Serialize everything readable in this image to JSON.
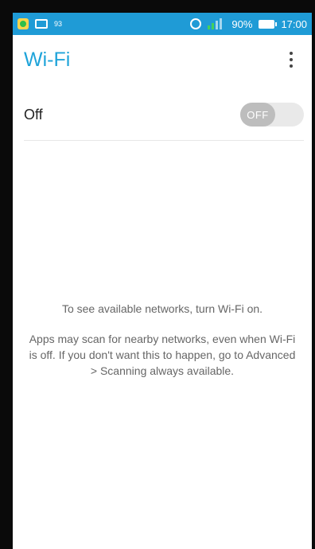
{
  "statusbar": {
    "left_value": "93",
    "battery": "90%",
    "time": "17:00"
  },
  "appbar": {
    "title": "Wi-Fi"
  },
  "wifi_toggle": {
    "label": "Off",
    "state_text": "OFF"
  },
  "message": {
    "line1": "To see available networks, turn Wi-Fi on.",
    "line2": "Apps may scan for nearby networks, even when Wi-Fi is off. If you don't want this to happen, go to Advanced > Scanning always available."
  },
  "colors": {
    "accent": "#1ea3d9",
    "statusbar": "#1f9bd6"
  }
}
